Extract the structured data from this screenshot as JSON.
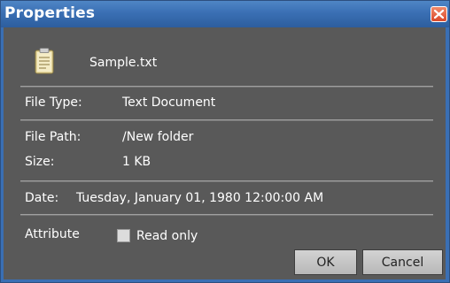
{
  "window": {
    "title": "Properties"
  },
  "file": {
    "name": "Sample.txt",
    "icon": "text-file-icon"
  },
  "details": {
    "file_type_label": "File Type:",
    "file_type_value": "Text Document",
    "file_path_label": "File Path:",
    "file_path_value": "/New folder",
    "size_label": "Size:",
    "size_value": "1 KB",
    "date_label": "Date:",
    "date_value": "Tuesday, January 01, 1980 12:00:00 AM"
  },
  "attributes": {
    "label": "Attribute",
    "read_only_label": "Read only",
    "read_only_checked": false
  },
  "buttons": {
    "ok_label": "OK",
    "cancel_label": "Cancel"
  },
  "colors": {
    "titlebar": "#3a6fb4",
    "body": "#595959",
    "close": "#d9482a",
    "text": "#ffffff"
  }
}
